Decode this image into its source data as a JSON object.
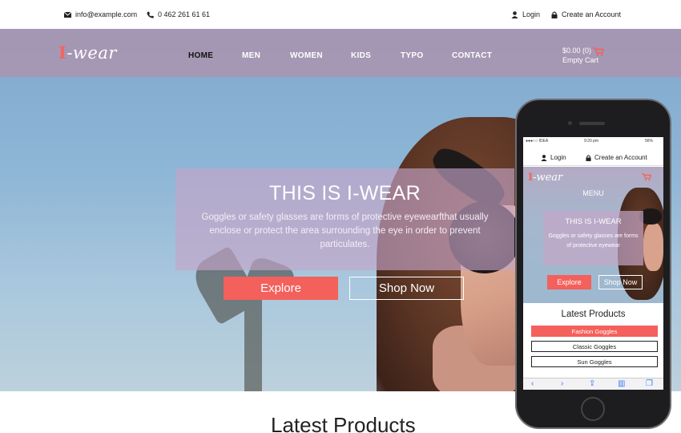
{
  "topbar": {
    "email": "info@example.com",
    "phone": "0 462 261 61 61",
    "login": "Login",
    "create_account": "Create an Account"
  },
  "brand": {
    "logo_i": "I",
    "logo_rest": "-wear"
  },
  "nav": {
    "items": [
      {
        "label": "HOME",
        "active": true
      },
      {
        "label": "MEN",
        "active": false
      },
      {
        "label": "WOMEN",
        "active": false
      },
      {
        "label": "KIDS",
        "active": false
      },
      {
        "label": "TYPO",
        "active": false
      },
      {
        "label": "CONTACT",
        "active": false
      }
    ]
  },
  "cart": {
    "amount": "$0.00 (0)",
    "status": "Empty Cart"
  },
  "hero": {
    "title": "THIS IS I-WEAR",
    "text": "Goggles or safety glasses are forms of protective eyewearfthat usually enclose or protect the area surrounding the eye in order to prevent particulates.",
    "explore_label": "Explore",
    "shop_label": "Shop Now"
  },
  "section": {
    "latest_title": "Latest Products"
  },
  "phone": {
    "status_carrier": "●●●○○ IDEA",
    "status_time": "9:20 pm",
    "status_battery": "56%",
    "login": "Login",
    "create_account": "Create an Account",
    "logo_i": "I",
    "logo_rest": "-wear",
    "menu": "MENU",
    "hero_title": "THIS IS I-WEAR",
    "hero_text": "Goggles or safety glasses are forms of protective eyewear",
    "explore_label": "Explore",
    "shop_label": "Shop Now",
    "latest_title": "Latest Products",
    "products": [
      "Fashion Goggles",
      "Classic Goggles",
      "Sun Goggles"
    ],
    "toolbar_icons": [
      "back-icon",
      "forward-icon",
      "share-icon",
      "bookmarks-icon",
      "tabs-icon"
    ]
  },
  "colors": {
    "accent": "#f4605b",
    "nav_bg": "#a796b2"
  }
}
